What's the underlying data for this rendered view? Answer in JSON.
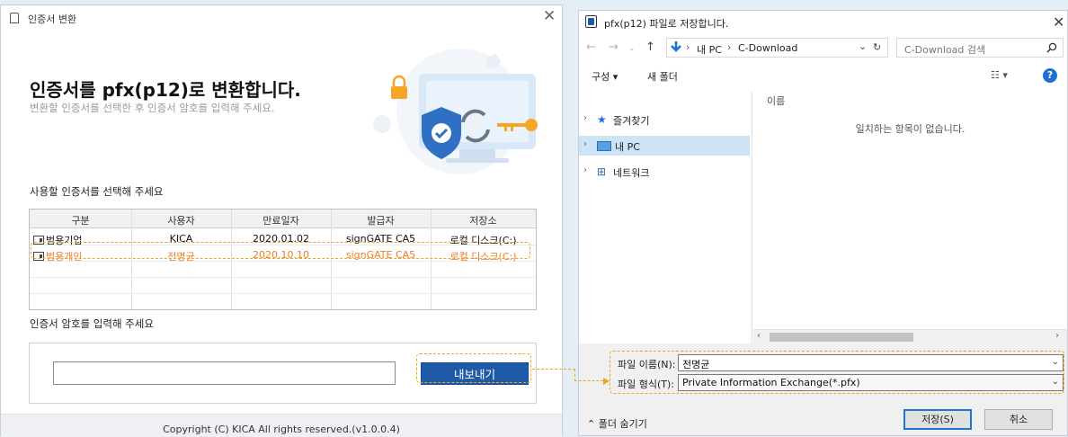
{
  "left_window": {
    "title": "인증서 변환",
    "close_glyph": "✕",
    "heading": "인증서를 pfx(p12)로 변환합니다.",
    "subheading": "변환할 인증서를 선택한 후 인증서 암호를 입력해 주세요.",
    "select_label": "사용할 인증서를 선택해 주세요",
    "table": {
      "columns": [
        "구분",
        "사용자",
        "만료일자",
        "발급자",
        "저장소"
      ],
      "rows": [
        [
          "범용기업",
          "KICA",
          "2020.01.02",
          "signGATE CA5",
          "로컬 디스크(C:)"
        ],
        [
          "범용개인",
          "전명균",
          "2020.10.10",
          "signGATE CA5",
          "로컬 디스크(C:)"
        ]
      ],
      "selected_row": 1
    },
    "password_label": "인증서 암호를 입력해 주세요",
    "password_value": "",
    "export_button": "내보내기",
    "copyright": "Copyright (C) KICA All rights reserved.(v1.0.0.4)"
  },
  "right_window": {
    "title": "pfx(p12) 파일로 저장합니다.",
    "close_glyph": "✕",
    "breadcrumb": [
      "내 PC",
      "C-Download"
    ],
    "breadcrumb_sep": "›",
    "search_placeholder": "C-Download 검색",
    "toolbar": {
      "organize": "구성 ▾",
      "new_folder": "새 폴더",
      "help": "?"
    },
    "nav": [
      {
        "label": "즐겨찾기",
        "icon": "star-icon",
        "glyph": "★"
      },
      {
        "label": "내 PC",
        "icon": "computer-icon",
        "glyph": "🖥"
      },
      {
        "label": "네트워크",
        "icon": "network-icon",
        "glyph": "⊞"
      }
    ],
    "column_header": "이름",
    "empty_message": "일치하는 항목이 없습니다.",
    "filename_label": "파일 이름(N):",
    "filename_value": "전명균",
    "filetype_label": "파일 형식(T):",
    "filetype_value": "Private Information Exchange(*.pfx)",
    "hide_folders": "⌃ 폴더 숨기기",
    "save_button": "저장(S)",
    "cancel_button": "취소"
  },
  "colors": {
    "accent_blue": "#1e5aa7",
    "highlight_orange": "#f0a619",
    "selected_text_orange": "#ee7d2a"
  }
}
